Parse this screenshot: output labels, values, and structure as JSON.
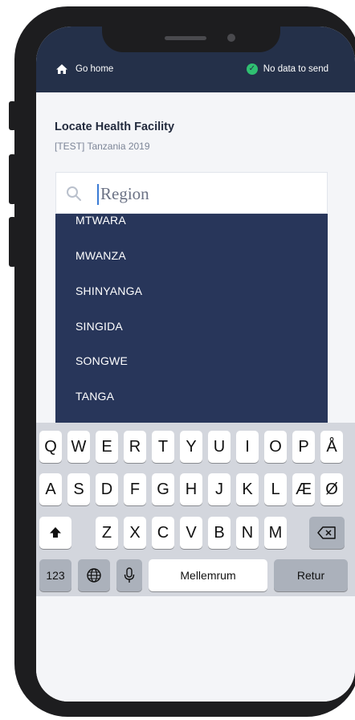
{
  "header": {
    "home_label": "Go home",
    "status_label": "No data to send"
  },
  "page": {
    "title": "Locate Health Facility",
    "subtitle": "[TEST] Tanzania 2019"
  },
  "search": {
    "placeholder": "Region"
  },
  "dropdown": {
    "items": [
      "MTWARA",
      "MWANZA",
      "SHINYANGA",
      "SINGIDA",
      "SONGWE",
      "TANGA"
    ]
  },
  "keyboard": {
    "row1": [
      "Q",
      "W",
      "E",
      "R",
      "T",
      "Y",
      "U",
      "I",
      "O",
      "P",
      "Å"
    ],
    "row2": [
      "A",
      "S",
      "D",
      "F",
      "G",
      "H",
      "J",
      "K",
      "L",
      "Æ",
      "Ø"
    ],
    "row3": [
      "Z",
      "X",
      "C",
      "V",
      "B",
      "N",
      "M"
    ],
    "numbers_label": "123",
    "space_label": "Mellemrum",
    "return_label": "Retur"
  },
  "colors": {
    "header_bg": "#243049",
    "dropdown_bg": "#28365a",
    "status_ok": "#2fbf71"
  },
  "icons": [
    "home-icon",
    "check-circle-icon",
    "search-icon",
    "shift-icon",
    "backspace-icon",
    "globe-icon",
    "microphone-icon"
  ]
}
